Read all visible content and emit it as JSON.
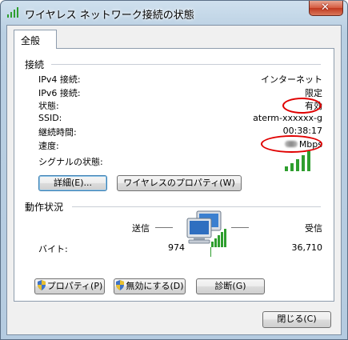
{
  "window": {
    "title": "ワイヤレス ネットワーク接続の状態",
    "close_symbol": "✕"
  },
  "tabs": [
    {
      "label": "全般"
    }
  ],
  "connection": {
    "section_title": "接続",
    "ipv4_label": "IPv4 接続:",
    "ipv4_value": "インターネット",
    "ipv6_label": "IPv6 接続:",
    "ipv6_value": "限定",
    "status_label": "状態:",
    "status_value": "有効",
    "ssid_label": "SSID:",
    "ssid_value": "aterm-xxxxxx-g",
    "duration_label": "継続時間:",
    "duration_value": "00:38:17",
    "speed_label": "速度:",
    "speed_value": "Mbps",
    "signal_label": "シグナルの状態:",
    "signal_bars": 5,
    "details_button": "詳細(E)...",
    "wireless_props_button": "ワイヤレスのプロパティ(W)"
  },
  "activity": {
    "section_title": "動作状況",
    "sent_label": "送信",
    "received_label": "受信",
    "bytes_label": "バイト:",
    "bytes_sent": "974",
    "bytes_received": "36,710"
  },
  "buttons": {
    "properties": "プロパティ(P)",
    "disable": "無効にする(D)",
    "diagnose": "診断(G)",
    "close": "閉じる(C)"
  },
  "colors": {
    "annotation": "#e00000",
    "signal": "#2e9e2e"
  }
}
